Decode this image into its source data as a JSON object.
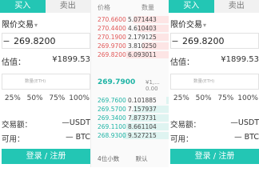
{
  "tabs": {
    "buy": "买入",
    "sell": "卖出"
  },
  "order_type": "限价交易",
  "price": "269.8200",
  "estimate_label": "估值：",
  "estimate_value": "¥1899.53",
  "qty_placeholder": "数量(ETH)",
  "percents": [
    "25%",
    "50%",
    "75%",
    "100%"
  ],
  "trade_amount_label": "交易额：",
  "trade_amount_value": "—USDT",
  "available_label": "可用：",
  "available_value": "— BTC",
  "login_label": "登录 / 注册",
  "orderbook": {
    "price_header": "价格",
    "qty_header": "数量",
    "asks": [
      {
        "price": "270.6600",
        "qty": "5.071443"
      },
      {
        "price": "270.4400",
        "qty": "4.610403"
      },
      {
        "price": "270.1900",
        "qty": "2.179125"
      },
      {
        "price": "269.9700",
        "qty": "3.810250"
      },
      {
        "price": "269.8200",
        "qty": "6.093011"
      }
    ],
    "last_price": "269.7900",
    "last_sub": "¥1,... 0.00",
    "bids": [
      {
        "price": "269.7600",
        "qty": "0.101885"
      },
      {
        "price": "269.5700",
        "qty": "7.157937"
      },
      {
        "price": "269.3400",
        "qty": "7.873731"
      },
      {
        "price": "269.1100",
        "qty": "8.661104"
      },
      {
        "price": "268.9300",
        "qty": "9.527215"
      }
    ],
    "footer_decimals": "4位小数",
    "footer_default": "默认"
  },
  "colors": {
    "buy": "#23c6b4",
    "ask": "#e25858",
    "bid": "#1fb4a5"
  }
}
